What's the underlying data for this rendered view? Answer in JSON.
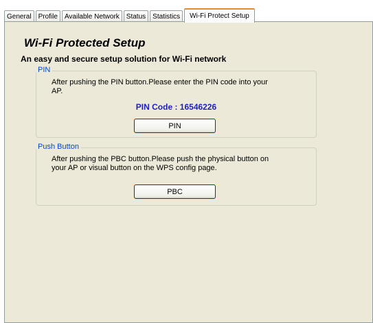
{
  "tabs": [
    {
      "label": "General"
    },
    {
      "label": "Profile"
    },
    {
      "label": "Available Network"
    },
    {
      "label": "Status"
    },
    {
      "label": "Statistics"
    },
    {
      "label": "Wi-Fi Protect Setup"
    }
  ],
  "active_tab": "Wi-Fi Protect Setup",
  "page": {
    "title": "Wi-Fi Protected Setup",
    "subtitle": "An easy and secure setup solution for Wi-Fi network"
  },
  "pin_group": {
    "legend": "PIN",
    "description_line1": "After pushing the PIN button.Please enter the PIN code into your",
    "description_line2": "AP.",
    "pin_code_label": "PIN Code :  16546226",
    "button_label": "PIN"
  },
  "pbc_group": {
    "legend": "Push Button",
    "description_line1": "After pushing the PBC button.Please push the physical button on",
    "description_line2": "your AP or visual button on the WPS config page.",
    "button_label": "PBC"
  },
  "colors": {
    "legend_text": "#0046d5",
    "pin_code_text": "#2020c0",
    "active_tab_highlight": "#e68b2c",
    "panel_background": "#ece9d8"
  }
}
